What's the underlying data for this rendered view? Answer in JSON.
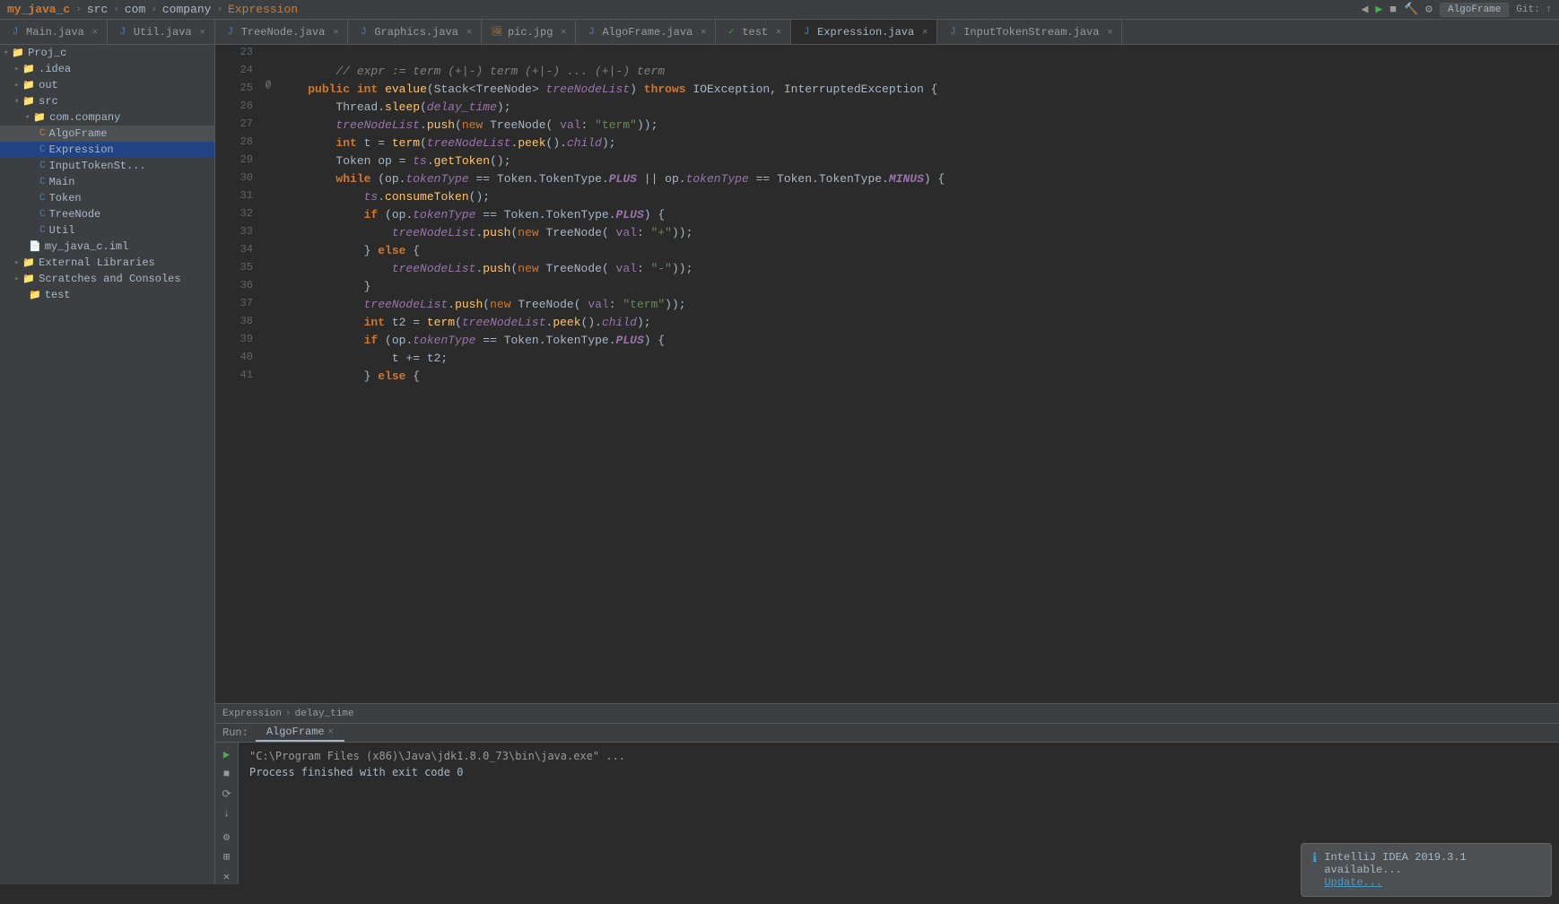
{
  "topbar": {
    "breadcrumb": [
      "my_java_c",
      "src",
      "com",
      "company",
      "Expression"
    ],
    "right_label": "AlgoFrame",
    "git_label": "Git: ↑"
  },
  "tabs": [
    {
      "label": "Main.java",
      "icon": "java",
      "active": false
    },
    {
      "label": "Util.java",
      "icon": "java",
      "active": false
    },
    {
      "label": "TreeNode.java",
      "icon": "java",
      "active": false
    },
    {
      "label": "Graphics.java",
      "icon": "java",
      "active": false
    },
    {
      "label": "pic.jpg",
      "icon": "img",
      "active": false
    },
    {
      "label": "AlgoFrame.java",
      "icon": "java",
      "active": false
    },
    {
      "label": "test",
      "icon": "test",
      "active": false
    },
    {
      "label": "Expression.java",
      "icon": "java",
      "active": true
    },
    {
      "label": "InputTokenStream.java",
      "icon": "java",
      "active": false
    }
  ],
  "sidebar": {
    "items": [
      {
        "label": "Proj_c",
        "indent": 0,
        "type": "project",
        "arrow": "▾"
      },
      {
        "label": ".idea",
        "indent": 1,
        "type": "folder",
        "arrow": "▸"
      },
      {
        "label": "out",
        "indent": 1,
        "type": "folder",
        "arrow": "▸"
      },
      {
        "label": "src",
        "indent": 1,
        "type": "folder",
        "arrow": "▾"
      },
      {
        "label": "com.company",
        "indent": 2,
        "type": "folder",
        "arrow": "▾"
      },
      {
        "label": "AlgoFrame",
        "indent": 3,
        "type": "java-orange",
        "selected": true
      },
      {
        "label": "Expression",
        "indent": 3,
        "type": "java-active"
      },
      {
        "label": "InputTokenSt...",
        "indent": 3,
        "type": "java"
      },
      {
        "label": "Main",
        "indent": 3,
        "type": "java"
      },
      {
        "label": "Token",
        "indent": 3,
        "type": "java"
      },
      {
        "label": "TreeNode",
        "indent": 3,
        "type": "java"
      },
      {
        "label": "Util",
        "indent": 3,
        "type": "java"
      },
      {
        "label": "my_java_c.iml",
        "indent": 2,
        "type": "iml"
      },
      {
        "label": "External Libraries",
        "indent": 1,
        "type": "folder",
        "arrow": "▸"
      },
      {
        "label": "Scratches and Consoles",
        "indent": 1,
        "type": "folder",
        "arrow": "▸"
      },
      {
        "label": "test",
        "indent": 2,
        "type": "folder"
      }
    ]
  },
  "code_lines": [
    {
      "num": 23,
      "content": "",
      "raw": ""
    },
    {
      "num": 24,
      "content": "comment",
      "raw": "        // expr := term (+|-) term (+|-) ... (+|-) term"
    },
    {
      "num": 25,
      "content": "method_sig",
      "raw": "    public int evalue(Stack<TreeNode> treeNodeList) throws IOException, InterruptedException {"
    },
    {
      "num": 26,
      "content": "normal",
      "raw": "        Thread.sleep(delay_time);"
    },
    {
      "num": 27,
      "content": "normal",
      "raw": "        treeNodeList.push(new TreeNode( val: \"term\"));"
    },
    {
      "num": 28,
      "content": "normal",
      "raw": "        int t = term(treeNodeList.peek().child);"
    },
    {
      "num": 29,
      "content": "normal",
      "raw": "        Token op = ts.getToken();"
    },
    {
      "num": 30,
      "content": "while",
      "raw": "        while (op.tokenType == Token.TokenType.PLUS || op.tokenType == Token.TokenType.MINUS) {"
    },
    {
      "num": 31,
      "content": "normal",
      "raw": "            ts.consumeToken();"
    },
    {
      "num": 32,
      "content": "normal",
      "raw": "            if (op.tokenType == Token.TokenType.PLUS) {"
    },
    {
      "num": 33,
      "content": "normal",
      "raw": "                treeNodeList.push(new TreeNode( val: \"+\"));"
    },
    {
      "num": 34,
      "content": "normal",
      "raw": "            } else {"
    },
    {
      "num": 35,
      "content": "normal",
      "raw": "                treeNodeList.push(new TreeNode( val: \"-\"));"
    },
    {
      "num": 36,
      "content": "normal",
      "raw": "            }"
    },
    {
      "num": 37,
      "content": "normal",
      "raw": "            treeNodeList.push(new TreeNode( val: \"term\"));"
    },
    {
      "num": 38,
      "content": "normal",
      "raw": "            int t2 = term(treeNodeList.peek().child);"
    },
    {
      "num": 39,
      "content": "normal",
      "raw": "            if (op.tokenType == Token.TokenType.PLUS) {"
    },
    {
      "num": 40,
      "content": "normal",
      "raw": "                t += t2;"
    },
    {
      "num": 41,
      "content": "partial",
      "raw": "            } else {"
    }
  ],
  "run_panel": {
    "tab": "AlgoFrame",
    "command": "\"C:\\Program Files (x86)\\Java\\jdk1.8.0_73\\bin\\java.exe\" ...",
    "result": "Process finished with exit code 0"
  },
  "status_bar": {
    "breadcrumb_items": [
      "Expression",
      "delay_time"
    ]
  },
  "notification": {
    "title": "IntelliJ IDEA 2019.3.1 available...",
    "link": "Update..."
  }
}
